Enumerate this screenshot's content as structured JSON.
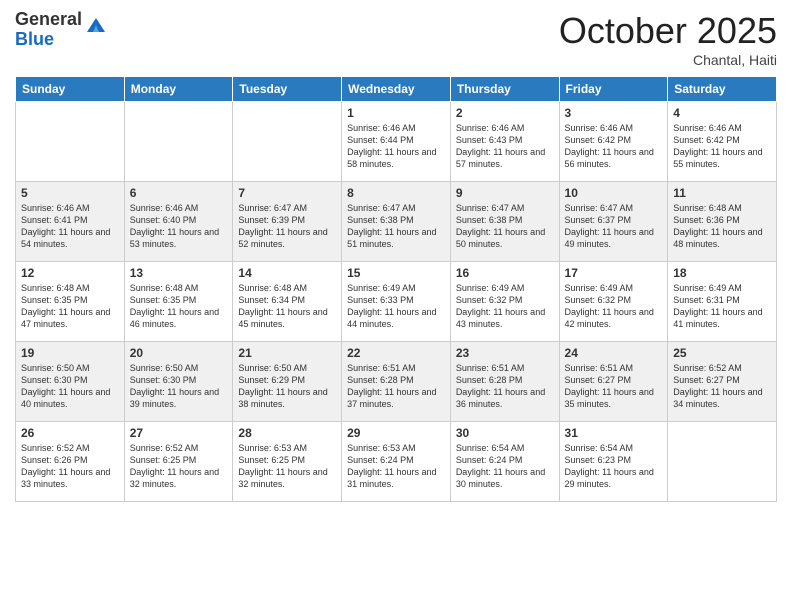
{
  "logo": {
    "general": "General",
    "blue": "Blue"
  },
  "header": {
    "month": "October 2025",
    "location": "Chantal, Haiti"
  },
  "days_of_week": [
    "Sunday",
    "Monday",
    "Tuesday",
    "Wednesday",
    "Thursday",
    "Friday",
    "Saturday"
  ],
  "weeks": [
    [
      {
        "day": "",
        "sunrise": "",
        "sunset": "",
        "daylight": ""
      },
      {
        "day": "",
        "sunrise": "",
        "sunset": "",
        "daylight": ""
      },
      {
        "day": "",
        "sunrise": "",
        "sunset": "",
        "daylight": ""
      },
      {
        "day": "1",
        "sunrise": "Sunrise: 6:46 AM",
        "sunset": "Sunset: 6:44 PM",
        "daylight": "Daylight: 11 hours and 58 minutes."
      },
      {
        "day": "2",
        "sunrise": "Sunrise: 6:46 AM",
        "sunset": "Sunset: 6:43 PM",
        "daylight": "Daylight: 11 hours and 57 minutes."
      },
      {
        "day": "3",
        "sunrise": "Sunrise: 6:46 AM",
        "sunset": "Sunset: 6:42 PM",
        "daylight": "Daylight: 11 hours and 56 minutes."
      },
      {
        "day": "4",
        "sunrise": "Sunrise: 6:46 AM",
        "sunset": "Sunset: 6:42 PM",
        "daylight": "Daylight: 11 hours and 55 minutes."
      }
    ],
    [
      {
        "day": "5",
        "sunrise": "Sunrise: 6:46 AM",
        "sunset": "Sunset: 6:41 PM",
        "daylight": "Daylight: 11 hours and 54 minutes."
      },
      {
        "day": "6",
        "sunrise": "Sunrise: 6:46 AM",
        "sunset": "Sunset: 6:40 PM",
        "daylight": "Daylight: 11 hours and 53 minutes."
      },
      {
        "day": "7",
        "sunrise": "Sunrise: 6:47 AM",
        "sunset": "Sunset: 6:39 PM",
        "daylight": "Daylight: 11 hours and 52 minutes."
      },
      {
        "day": "8",
        "sunrise": "Sunrise: 6:47 AM",
        "sunset": "Sunset: 6:38 PM",
        "daylight": "Daylight: 11 hours and 51 minutes."
      },
      {
        "day": "9",
        "sunrise": "Sunrise: 6:47 AM",
        "sunset": "Sunset: 6:38 PM",
        "daylight": "Daylight: 11 hours and 50 minutes."
      },
      {
        "day": "10",
        "sunrise": "Sunrise: 6:47 AM",
        "sunset": "Sunset: 6:37 PM",
        "daylight": "Daylight: 11 hours and 49 minutes."
      },
      {
        "day": "11",
        "sunrise": "Sunrise: 6:48 AM",
        "sunset": "Sunset: 6:36 PM",
        "daylight": "Daylight: 11 hours and 48 minutes."
      }
    ],
    [
      {
        "day": "12",
        "sunrise": "Sunrise: 6:48 AM",
        "sunset": "Sunset: 6:35 PM",
        "daylight": "Daylight: 11 hours and 47 minutes."
      },
      {
        "day": "13",
        "sunrise": "Sunrise: 6:48 AM",
        "sunset": "Sunset: 6:35 PM",
        "daylight": "Daylight: 11 hours and 46 minutes."
      },
      {
        "day": "14",
        "sunrise": "Sunrise: 6:48 AM",
        "sunset": "Sunset: 6:34 PM",
        "daylight": "Daylight: 11 hours and 45 minutes."
      },
      {
        "day": "15",
        "sunrise": "Sunrise: 6:49 AM",
        "sunset": "Sunset: 6:33 PM",
        "daylight": "Daylight: 11 hours and 44 minutes."
      },
      {
        "day": "16",
        "sunrise": "Sunrise: 6:49 AM",
        "sunset": "Sunset: 6:32 PM",
        "daylight": "Daylight: 11 hours and 43 minutes."
      },
      {
        "day": "17",
        "sunrise": "Sunrise: 6:49 AM",
        "sunset": "Sunset: 6:32 PM",
        "daylight": "Daylight: 11 hours and 42 minutes."
      },
      {
        "day": "18",
        "sunrise": "Sunrise: 6:49 AM",
        "sunset": "Sunset: 6:31 PM",
        "daylight": "Daylight: 11 hours and 41 minutes."
      }
    ],
    [
      {
        "day": "19",
        "sunrise": "Sunrise: 6:50 AM",
        "sunset": "Sunset: 6:30 PM",
        "daylight": "Daylight: 11 hours and 40 minutes."
      },
      {
        "day": "20",
        "sunrise": "Sunrise: 6:50 AM",
        "sunset": "Sunset: 6:30 PM",
        "daylight": "Daylight: 11 hours and 39 minutes."
      },
      {
        "day": "21",
        "sunrise": "Sunrise: 6:50 AM",
        "sunset": "Sunset: 6:29 PM",
        "daylight": "Daylight: 11 hours and 38 minutes."
      },
      {
        "day": "22",
        "sunrise": "Sunrise: 6:51 AM",
        "sunset": "Sunset: 6:28 PM",
        "daylight": "Daylight: 11 hours and 37 minutes."
      },
      {
        "day": "23",
        "sunrise": "Sunrise: 6:51 AM",
        "sunset": "Sunset: 6:28 PM",
        "daylight": "Daylight: 11 hours and 36 minutes."
      },
      {
        "day": "24",
        "sunrise": "Sunrise: 6:51 AM",
        "sunset": "Sunset: 6:27 PM",
        "daylight": "Daylight: 11 hours and 35 minutes."
      },
      {
        "day": "25",
        "sunrise": "Sunrise: 6:52 AM",
        "sunset": "Sunset: 6:27 PM",
        "daylight": "Daylight: 11 hours and 34 minutes."
      }
    ],
    [
      {
        "day": "26",
        "sunrise": "Sunrise: 6:52 AM",
        "sunset": "Sunset: 6:26 PM",
        "daylight": "Daylight: 11 hours and 33 minutes."
      },
      {
        "day": "27",
        "sunrise": "Sunrise: 6:52 AM",
        "sunset": "Sunset: 6:25 PM",
        "daylight": "Daylight: 11 hours and 32 minutes."
      },
      {
        "day": "28",
        "sunrise": "Sunrise: 6:53 AM",
        "sunset": "Sunset: 6:25 PM",
        "daylight": "Daylight: 11 hours and 32 minutes."
      },
      {
        "day": "29",
        "sunrise": "Sunrise: 6:53 AM",
        "sunset": "Sunset: 6:24 PM",
        "daylight": "Daylight: 11 hours and 31 minutes."
      },
      {
        "day": "30",
        "sunrise": "Sunrise: 6:54 AM",
        "sunset": "Sunset: 6:24 PM",
        "daylight": "Daylight: 11 hours and 30 minutes."
      },
      {
        "day": "31",
        "sunrise": "Sunrise: 6:54 AM",
        "sunset": "Sunset: 6:23 PM",
        "daylight": "Daylight: 11 hours and 29 minutes."
      },
      {
        "day": "",
        "sunrise": "",
        "sunset": "",
        "daylight": ""
      }
    ]
  ]
}
